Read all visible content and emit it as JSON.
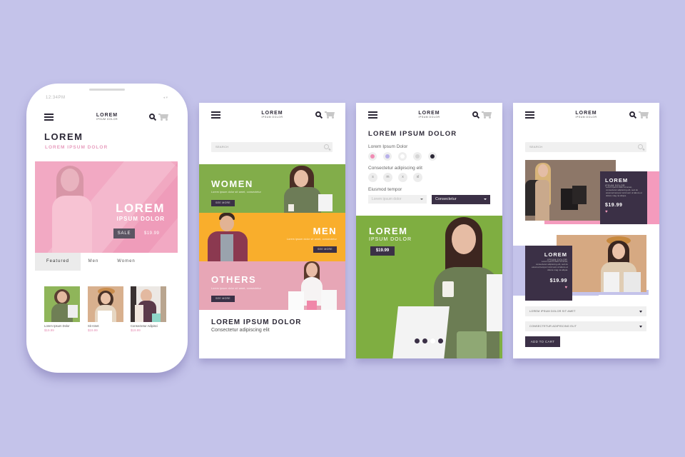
{
  "colors": {
    "background": "#c4c3ea",
    "dark": "#3b3046",
    "pink": "#f49bbd",
    "green": "#7fae41",
    "orange": "#f9ae2c",
    "rose": "#e7a6b6"
  },
  "brand": {
    "logo_main": "LOREM",
    "logo_sub": "IPSUM DOLOR"
  },
  "screen1": {
    "status_time": "12:34PM",
    "status_icons": "◂ ▾",
    "title": "LOREM",
    "subtitle": "LOREM IPSUM DOLOR",
    "hero": {
      "title": "LOREM",
      "subtitle": "IPSUM DOLOR",
      "badge": "SALE",
      "price": "$19.99"
    },
    "tabs": [
      {
        "label": "Featured",
        "active": true
      },
      {
        "label": "Men",
        "active": false
      },
      {
        "label": "Women",
        "active": false
      }
    ],
    "products": [
      {
        "name": "Lorem Ipsum Dolor",
        "price": "$19.99"
      },
      {
        "name": "Sit Amet",
        "price": "$19.99"
      },
      {
        "name": "Consectetur Adipisci",
        "price": "$19.99"
      }
    ]
  },
  "screen2": {
    "search_placeholder": "SEARCH",
    "categories": [
      {
        "title": "WOMEN",
        "subtitle": "Lorem ipsum dolor sit amet, consectetur",
        "button": "SEE MORE"
      },
      {
        "title": "MEN",
        "subtitle": "Lorem ipsum dolor sit amet, consectetur",
        "button": "SEE MORE"
      },
      {
        "title": "OTHERS",
        "subtitle": "Lorem ipsum dolor sit amet, consectetur",
        "button": "SEE MORE"
      }
    ],
    "footer_title": "LOREM IPSUM DOLOR",
    "footer_subtitle": "Consectetur adipiscing elit"
  },
  "screen3": {
    "title": "LOREM IPSUM DOLOR",
    "color_label": "Lorem Ipsum Dolor",
    "colors": [
      "#f08cb4",
      "#b8b1ea",
      "#ffffff",
      "#d6d6d6",
      "#2c2836"
    ],
    "size_label": "Consectetur adipiscing elit",
    "sizes": [
      "s",
      "m",
      "x",
      "xl"
    ],
    "select_label": "Eiusmod tempor",
    "select1_value": "Lorem ipsum dolor",
    "select2_value": "Consectetur",
    "promo": {
      "title": "LOREM",
      "subtitle": "IPSUM DOLOR",
      "price": "$19.99"
    },
    "carousel": {
      "count": 4,
      "active_index": 2
    }
  },
  "screen4": {
    "search_placeholder": "SEARCH",
    "product1": {
      "title": "LOREM",
      "subtitle": "IPSUM DOLOR",
      "description": "Lorem ipsum dolor sit amet, consectetur adipiscing elit, sed do eiusmod tempor incid sunt ut labore et dolore mag na aliqua.",
      "price": "$19.99"
    },
    "product2": {
      "title": "LOREM",
      "subtitle": "IPSUM DOLOR",
      "description": "Lorem ipsum dolor sit amet, consectetur adipiscing elit, sed do eiusmod tempor incid sunt ut labore et dolore mag na aliqua.",
      "price": "$19.99"
    },
    "dropdown1": "LOREM IPSUM DOLOR SIT AMET",
    "dropdown2": "CONSECTETUR ADIPISCING ELIT",
    "add_to_cart": "ADD TO CART"
  }
}
